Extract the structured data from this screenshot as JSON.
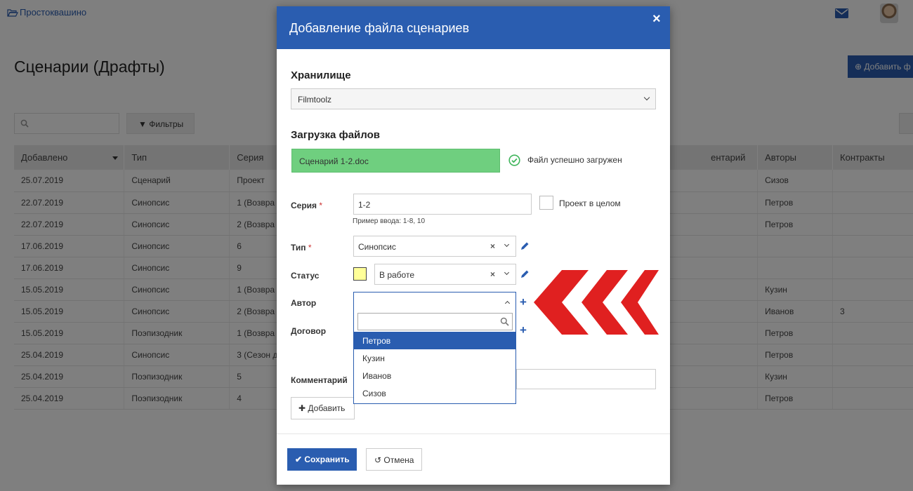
{
  "app": {
    "brand": "Простоквашино",
    "page_title": "Сценарии (Драфты)",
    "add_button": "Добавить ф"
  },
  "toolbar": {
    "filters_label": "Фильтры"
  },
  "table": {
    "headers": [
      "Добавлено",
      "Тип",
      "Серия",
      "ентарий",
      "Авторы",
      "Контракты"
    ],
    "rows": [
      [
        "25.07.2019",
        "Сценарий",
        "Проект",
        "",
        "Сизов",
        ""
      ],
      [
        "22.07.2019",
        "Синопсис",
        "1 (Возвра",
        "",
        "Петров",
        ""
      ],
      [
        "22.07.2019",
        "Синопсис",
        "2 (Возвра",
        "",
        "Петров",
        ""
      ],
      [
        "17.06.2019",
        "Синопсис",
        "6",
        "",
        "",
        ""
      ],
      [
        "17.06.2019",
        "Синопсис",
        "9",
        "",
        "",
        ""
      ],
      [
        "15.05.2019",
        "Синопсис",
        "1 (Возвра",
        "",
        "Кузин",
        ""
      ],
      [
        "15.05.2019",
        "Синопсис",
        "2 (Возвра",
        "",
        "Иванов",
        "3"
      ],
      [
        "15.05.2019",
        "Поэпизодник",
        "1 (Возвра",
        "",
        "Петров",
        ""
      ],
      [
        "25.04.2019",
        "Синопсис",
        "3 (Сезон д",
        "",
        "Петров",
        ""
      ],
      [
        "25.04.2019",
        "Поэпизодник",
        "5",
        "",
        "Кузин",
        ""
      ],
      [
        "25.04.2019",
        "Поэпизодник",
        "4",
        "",
        "Петров",
        ""
      ]
    ]
  },
  "modal": {
    "title": "Добавление файла сценариев",
    "close": "×",
    "storage": {
      "label": "Хранилище",
      "value": "Filmtoolz"
    },
    "upload": {
      "label": "Загрузка файлов",
      "file_name": "Сценарий 1-2.doc",
      "status": "Файл успешно загружен"
    },
    "series": {
      "label": "Серия",
      "required": "*",
      "value": "1-2",
      "hint": "Пример ввода: 1-8, 10",
      "whole_project_label": "Проект в целом"
    },
    "type": {
      "label": "Тип",
      "required": "*",
      "value": "Синопсис"
    },
    "status": {
      "label": "Статус",
      "value": "В работе",
      "color": "#ffff99"
    },
    "author": {
      "label": "Автор",
      "options": [
        "Петров",
        "Кузин",
        "Иванов",
        "Сизов"
      ],
      "highlighted": "Петров"
    },
    "contract": {
      "label": "Договор"
    },
    "comment": {
      "label": "Комментарий"
    },
    "add_button": "Добавить",
    "save_button": "Сохранить",
    "cancel_button": "Отмена"
  },
  "colors": {
    "primary": "#2a5db0",
    "success": "#6fcf7f",
    "annotation": "#e02020"
  }
}
